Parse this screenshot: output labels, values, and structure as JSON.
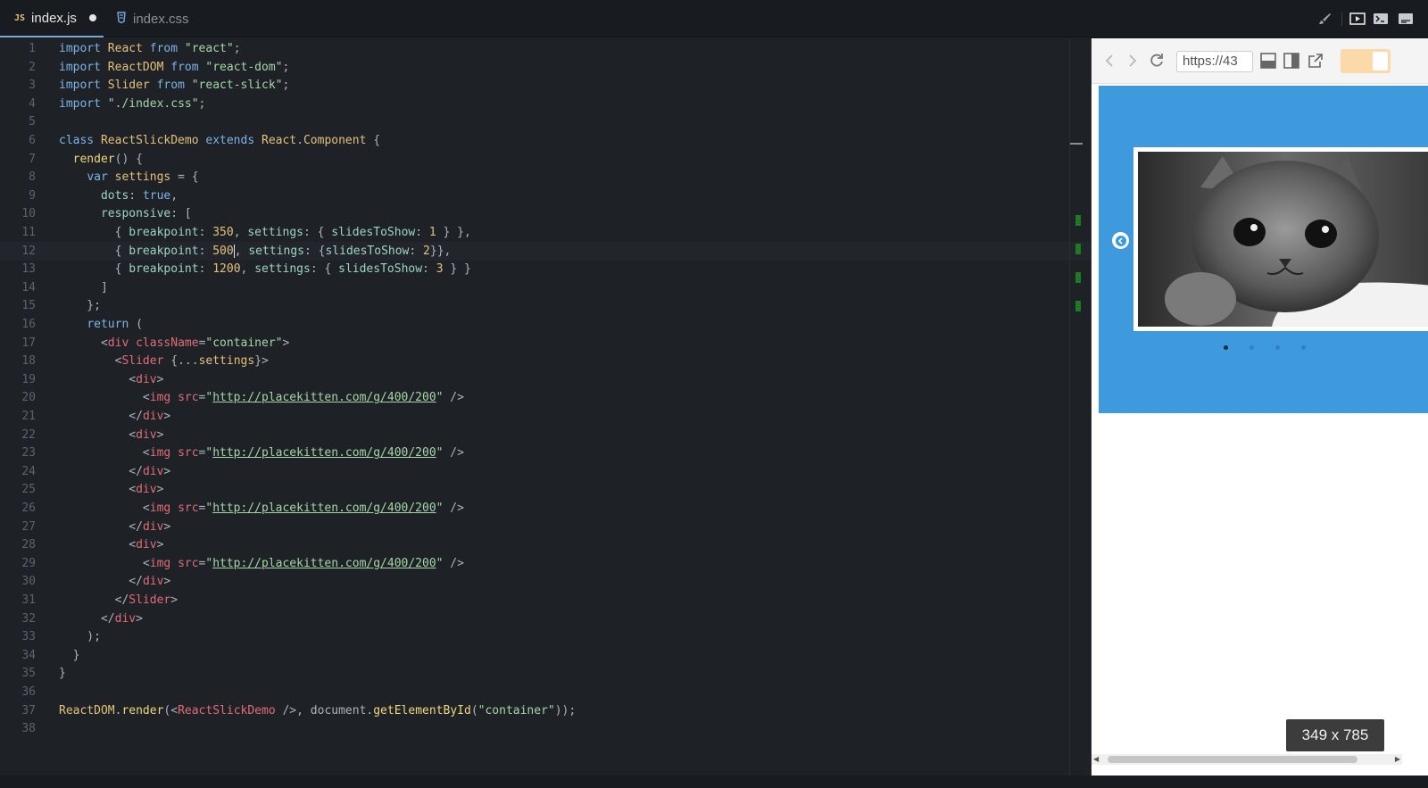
{
  "tabs": [
    {
      "label": "index.js",
      "type_badge": "JS",
      "modified": true,
      "active": true
    },
    {
      "label": "index.css",
      "type_badge": "css",
      "modified": false,
      "active": false
    }
  ],
  "toolbar_icons": [
    "brush-icon",
    "preview-icon",
    "terminal-icon",
    "console-icon"
  ],
  "editor": {
    "current_line": 12,
    "lines": [
      "import React from \"react\";",
      "import ReactDOM from \"react-dom\";",
      "import Slider from \"react-slick\";",
      "import \"./index.css\";",
      "",
      "class ReactSlickDemo extends React.Component {",
      "  render() {",
      "    var settings = {",
      "      dots: true,",
      "      responsive: [",
      "        { breakpoint: 350, settings: { slidesToShow: 1 } },",
      "        { breakpoint: 500, settings: {slidesToShow: 2}},",
      "        { breakpoint: 1200, settings: { slidesToShow: 3 } }",
      "      ]",
      "    };",
      "    return (",
      "      <div className=\"container\">",
      "        <Slider {...settings}>",
      "          <div>",
      "            <img src=\"http://placekitten.com/g/400/200\" />",
      "          </div>",
      "          <div>",
      "            <img src=\"http://placekitten.com/g/400/200\" />",
      "          </div>",
      "          <div>",
      "            <img src=\"http://placekitten.com/g/400/200\" />",
      "          </div>",
      "          <div>",
      "            <img src=\"http://placekitten.com/g/400/200\" />",
      "          </div>",
      "        </Slider>",
      "      </div>",
      "    );",
      "  }",
      "}",
      "",
      "ReactDOM.render(<ReactSlickDemo />, document.getElementById(\"container\"));",
      ""
    ]
  },
  "preview": {
    "url": "https://43",
    "size_label": "349 x 785",
    "carousel": {
      "dot_count": 4,
      "active_dot": 0,
      "image": "kitten-photo"
    }
  },
  "colors": {
    "accent": "#7aa6da",
    "carousel_bg": "#3f99dd",
    "toggle": "#fcd9a8",
    "diff_marker": "#1e7a1e"
  }
}
